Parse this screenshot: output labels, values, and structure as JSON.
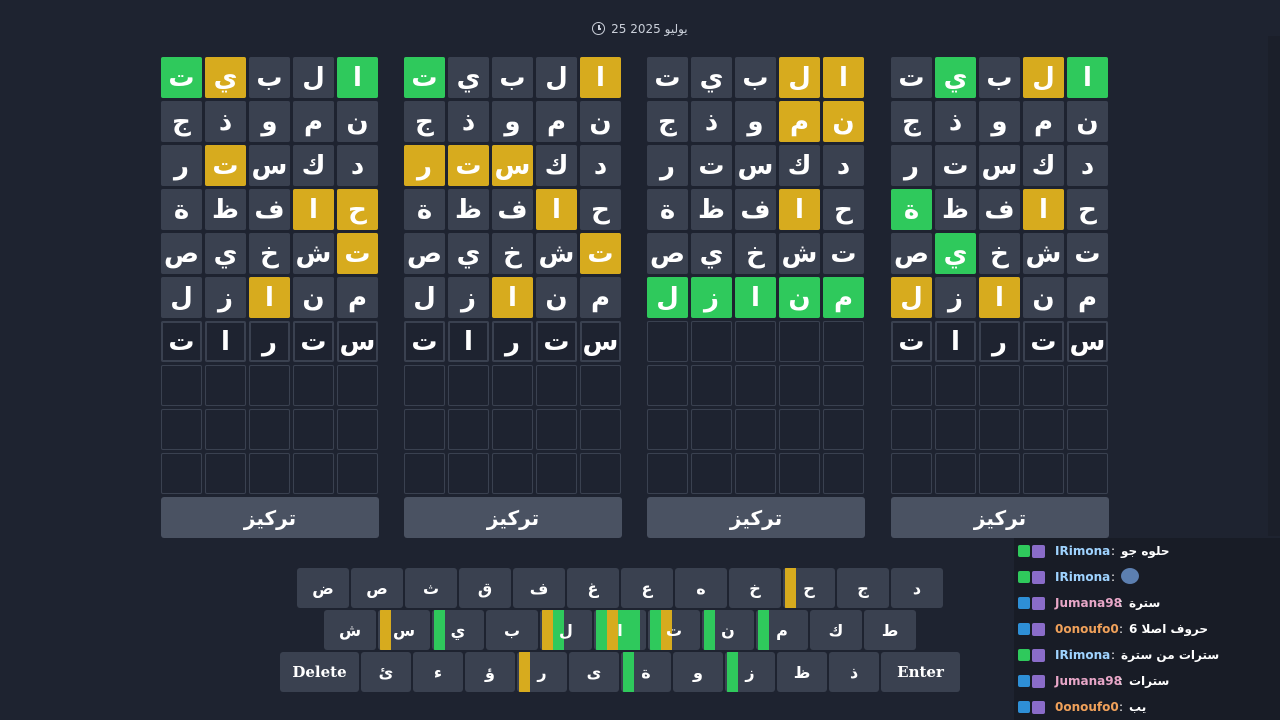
{
  "header": {
    "date": "25 يوليو 2025"
  },
  "boards": [
    {
      "rows": [
        [
          [
            "ت",
            "g"
          ],
          [
            "ي",
            "y"
          ],
          [
            "ب",
            "f"
          ],
          [
            "ل",
            "f"
          ],
          [
            "ا",
            "g"
          ]
        ],
        [
          [
            "ج",
            "f"
          ],
          [
            "ذ",
            "f"
          ],
          [
            "و",
            "f"
          ],
          [
            "م",
            "f"
          ],
          [
            "ن",
            "f"
          ]
        ],
        [
          [
            "ر",
            "f"
          ],
          [
            "ت",
            "y"
          ],
          [
            "س",
            "f"
          ],
          [
            "ك",
            "f"
          ],
          [
            "د",
            "f"
          ]
        ],
        [
          [
            "ة",
            "f"
          ],
          [
            "ظ",
            "f"
          ],
          [
            "ف",
            "f"
          ],
          [
            "ا",
            "y"
          ],
          [
            "ح",
            "y"
          ]
        ],
        [
          [
            "ص",
            "f"
          ],
          [
            "ي",
            "f"
          ],
          [
            "خ",
            "f"
          ],
          [
            "ش",
            "f"
          ],
          [
            "ت",
            "y"
          ]
        ],
        [
          [
            "ل",
            "f"
          ],
          [
            "ز",
            "f"
          ],
          [
            "ا",
            "y"
          ],
          [
            "ن",
            "f"
          ],
          [
            "م",
            "f"
          ]
        ],
        [
          [
            "ت",
            "t"
          ],
          [
            "ا",
            "t"
          ],
          [
            "ر",
            "t"
          ],
          [
            "ت",
            "t"
          ],
          [
            "س",
            "t"
          ]
        ],
        [
          [
            "",
            "e"
          ],
          [
            "",
            "e"
          ],
          [
            "",
            "e"
          ],
          [
            "",
            "e"
          ],
          [
            "",
            "e"
          ]
        ],
        [
          [
            "",
            "e"
          ],
          [
            "",
            "e"
          ],
          [
            "",
            "e"
          ],
          [
            "",
            "e"
          ],
          [
            "",
            "e"
          ]
        ],
        [
          [
            "",
            "e"
          ],
          [
            "",
            "e"
          ],
          [
            "",
            "e"
          ],
          [
            "",
            "e"
          ],
          [
            "",
            "e"
          ]
        ]
      ],
      "focus": "تركيز"
    },
    {
      "rows": [
        [
          [
            "ت",
            "f"
          ],
          [
            "ي",
            "f"
          ],
          [
            "ب",
            "f"
          ],
          [
            "ل",
            "y"
          ],
          [
            "ا",
            "y"
          ]
        ],
        [
          [
            "ج",
            "f"
          ],
          [
            "ذ",
            "f"
          ],
          [
            "و",
            "f"
          ],
          [
            "م",
            "y"
          ],
          [
            "ن",
            "y"
          ]
        ],
        [
          [
            "ر",
            "f"
          ],
          [
            "ت",
            "f"
          ],
          [
            "س",
            "f"
          ],
          [
            "ك",
            "f"
          ],
          [
            "د",
            "f"
          ]
        ],
        [
          [
            "ة",
            "f"
          ],
          [
            "ظ",
            "f"
          ],
          [
            "ف",
            "f"
          ],
          [
            "ا",
            "y"
          ],
          [
            "ح",
            "f"
          ]
        ],
        [
          [
            "ص",
            "f"
          ],
          [
            "ي",
            "f"
          ],
          [
            "خ",
            "f"
          ],
          [
            "ش",
            "f"
          ],
          [
            "ت",
            "f"
          ]
        ],
        [
          [
            "ل",
            "g"
          ],
          [
            "ز",
            "g"
          ],
          [
            "ا",
            "g"
          ],
          [
            "ن",
            "g"
          ],
          [
            "م",
            "g"
          ]
        ],
        [
          [
            "",
            "e"
          ],
          [
            "",
            "e"
          ],
          [
            "",
            "e"
          ],
          [
            "",
            "e"
          ],
          [
            "",
            "e"
          ]
        ],
        [
          [
            "",
            "e"
          ],
          [
            "",
            "e"
          ],
          [
            "",
            "e"
          ],
          [
            "",
            "e"
          ],
          [
            "",
            "e"
          ]
        ],
        [
          [
            "",
            "e"
          ],
          [
            "",
            "e"
          ],
          [
            "",
            "e"
          ],
          [
            "",
            "e"
          ],
          [
            "",
            "e"
          ]
        ],
        [
          [
            "",
            "e"
          ],
          [
            "",
            "e"
          ],
          [
            "",
            "e"
          ],
          [
            "",
            "e"
          ],
          [
            "",
            "e"
          ]
        ]
      ],
      "focus": "تركيز"
    },
    {
      "rows": [
        [
          [
            "ت",
            "g"
          ],
          [
            "ي",
            "f"
          ],
          [
            "ب",
            "f"
          ],
          [
            "ل",
            "f"
          ],
          [
            "ا",
            "y"
          ]
        ],
        [
          [
            "ج",
            "f"
          ],
          [
            "ذ",
            "f"
          ],
          [
            "و",
            "f"
          ],
          [
            "م",
            "f"
          ],
          [
            "ن",
            "f"
          ]
        ],
        [
          [
            "ر",
            "y"
          ],
          [
            "ت",
            "y"
          ],
          [
            "س",
            "y"
          ],
          [
            "ك",
            "f"
          ],
          [
            "د",
            "f"
          ]
        ],
        [
          [
            "ة",
            "f"
          ],
          [
            "ظ",
            "f"
          ],
          [
            "ف",
            "f"
          ],
          [
            "ا",
            "y"
          ],
          [
            "ح",
            "f"
          ]
        ],
        [
          [
            "ص",
            "f"
          ],
          [
            "ي",
            "f"
          ],
          [
            "خ",
            "f"
          ],
          [
            "ش",
            "f"
          ],
          [
            "ت",
            "y"
          ]
        ],
        [
          [
            "ل",
            "f"
          ],
          [
            "ز",
            "f"
          ],
          [
            "ا",
            "y"
          ],
          [
            "ن",
            "f"
          ],
          [
            "م",
            "f"
          ]
        ],
        [
          [
            "ت",
            "t"
          ],
          [
            "ا",
            "t"
          ],
          [
            "ر",
            "t"
          ],
          [
            "ت",
            "t"
          ],
          [
            "س",
            "t"
          ]
        ],
        [
          [
            "",
            "e"
          ],
          [
            "",
            "e"
          ],
          [
            "",
            "e"
          ],
          [
            "",
            "e"
          ],
          [
            "",
            "e"
          ]
        ],
        [
          [
            "",
            "e"
          ],
          [
            "",
            "e"
          ],
          [
            "",
            "e"
          ],
          [
            "",
            "e"
          ],
          [
            "",
            "e"
          ]
        ],
        [
          [
            "",
            "e"
          ],
          [
            "",
            "e"
          ],
          [
            "",
            "e"
          ],
          [
            "",
            "e"
          ],
          [
            "",
            "e"
          ]
        ]
      ],
      "focus": "تركيز"
    },
    {
      "rows": [
        [
          [
            "ت",
            "f"
          ],
          [
            "ي",
            "g"
          ],
          [
            "ب",
            "f"
          ],
          [
            "ل",
            "y"
          ],
          [
            "ا",
            "g"
          ]
        ],
        [
          [
            "ج",
            "f"
          ],
          [
            "ذ",
            "f"
          ],
          [
            "و",
            "f"
          ],
          [
            "م",
            "f"
          ],
          [
            "ن",
            "f"
          ]
        ],
        [
          [
            "ر",
            "f"
          ],
          [
            "ت",
            "f"
          ],
          [
            "س",
            "f"
          ],
          [
            "ك",
            "f"
          ],
          [
            "د",
            "f"
          ]
        ],
        [
          [
            "ة",
            "g"
          ],
          [
            "ظ",
            "f"
          ],
          [
            "ف",
            "f"
          ],
          [
            "ا",
            "y"
          ],
          [
            "ح",
            "f"
          ]
        ],
        [
          [
            "ص",
            "f"
          ],
          [
            "ي",
            "g"
          ],
          [
            "خ",
            "f"
          ],
          [
            "ش",
            "f"
          ],
          [
            "ت",
            "f"
          ]
        ],
        [
          [
            "ل",
            "y"
          ],
          [
            "ز",
            "f"
          ],
          [
            "ا",
            "y"
          ],
          [
            "ن",
            "f"
          ],
          [
            "م",
            "f"
          ]
        ],
        [
          [
            "ت",
            "t"
          ],
          [
            "ا",
            "t"
          ],
          [
            "ر",
            "t"
          ],
          [
            "ت",
            "t"
          ],
          [
            "س",
            "t"
          ]
        ],
        [
          [
            "",
            "e"
          ],
          [
            "",
            "e"
          ],
          [
            "",
            "e"
          ],
          [
            "",
            "e"
          ],
          [
            "",
            "e"
          ]
        ],
        [
          [
            "",
            "e"
          ],
          [
            "",
            "e"
          ],
          [
            "",
            "e"
          ],
          [
            "",
            "e"
          ],
          [
            "",
            "e"
          ]
        ],
        [
          [
            "",
            "e"
          ],
          [
            "",
            "e"
          ],
          [
            "",
            "e"
          ],
          [
            "",
            "e"
          ],
          [
            "",
            "e"
          ]
        ]
      ],
      "focus": "تركيز"
    }
  ],
  "keyboard": {
    "rows": [
      [
        {
          "k": "ض"
        },
        {
          "k": "ص"
        },
        {
          "k": "ث"
        },
        {
          "k": "ق"
        },
        {
          "k": "ف"
        },
        {
          "k": "غ"
        },
        {
          "k": "ع"
        },
        {
          "k": "ه"
        },
        {
          "k": "خ"
        },
        {
          "k": "ح",
          "marks": [
            "yellow"
          ]
        },
        {
          "k": "ج"
        },
        {
          "k": "د"
        }
      ],
      [
        {
          "k": "ش"
        },
        {
          "k": "س",
          "marks": [
            "yellow"
          ]
        },
        {
          "k": "ي",
          "marks": [
            "green"
          ]
        },
        {
          "k": "ب"
        },
        {
          "k": "ل",
          "marks": [
            "yellow",
            "green"
          ]
        },
        {
          "k": "ا",
          "marks": [
            "green",
            "yellow",
            "green",
            "green"
          ]
        },
        {
          "k": "ت",
          "marks": [
            "green",
            "yellow"
          ]
        },
        {
          "k": "ن",
          "marks": [
            "green"
          ]
        },
        {
          "k": "م",
          "marks": [
            "green"
          ]
        },
        {
          "k": "ك"
        },
        {
          "k": "ط"
        }
      ],
      [
        {
          "k": "Delete",
          "wide": true
        },
        {
          "k": "ئ"
        },
        {
          "k": "ء"
        },
        {
          "k": "ؤ"
        },
        {
          "k": "ر",
          "marks": [
            "yellow"
          ]
        },
        {
          "k": "ى"
        },
        {
          "k": "ة",
          "marks": [
            "green"
          ]
        },
        {
          "k": "و"
        },
        {
          "k": "ز",
          "marks": [
            "green"
          ]
        },
        {
          "k": "ظ"
        },
        {
          "k": "ذ"
        },
        {
          "k": "Enter",
          "wide": true
        }
      ]
    ]
  },
  "chat": [
    {
      "user": "IRimona",
      "text": "حلوه جو",
      "color": "#9fd3ff",
      "badge": "#2fc95c"
    },
    {
      "user": "IRimona",
      "text": "",
      "emote": true,
      "color": "#9fd3ff",
      "badge": "#2fc95c"
    },
    {
      "user": "Jumana98",
      "text": "سترة",
      "color": "#e8a7c8",
      "badge": "#2e8fd6"
    },
    {
      "user": "0onoufo0",
      "text": "حروف اصلا 6",
      "color": "#f0a15a",
      "badge": "#2e8fd6"
    },
    {
      "user": "IRimona",
      "text": "سترات من سترة",
      "color": "#9fd3ff",
      "badge": "#2fc95c"
    },
    {
      "user": "Jumana98",
      "text": "سترات",
      "color": "#e8a7c8",
      "badge": "#2e8fd6"
    },
    {
      "user": "0onoufo0",
      "text": "يب",
      "color": "#f0a15a",
      "badge": "#2e8fd6"
    }
  ],
  "colors": {
    "green": "#2fc95c",
    "yellow": "#d7ab1e",
    "tile": "#3a4150",
    "bg": "#1e2330"
  }
}
